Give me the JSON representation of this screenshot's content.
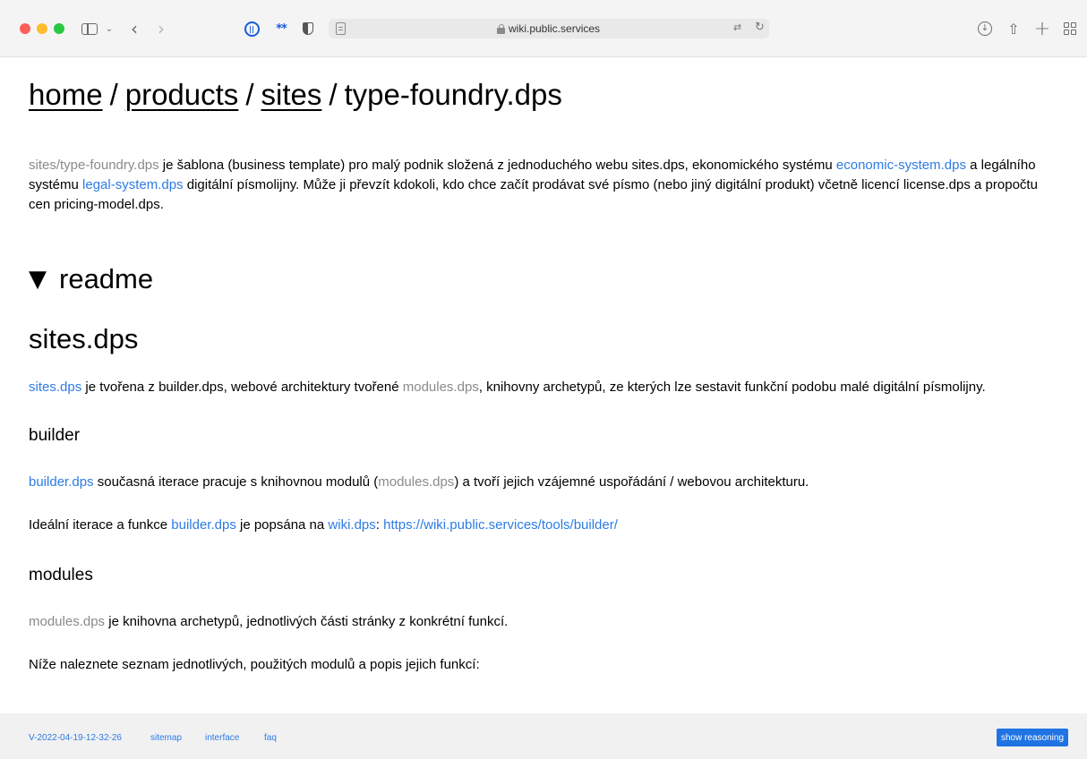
{
  "browser": {
    "url": "wiki.public.services",
    "ext_stars": "**"
  },
  "breadcrumb": {
    "items": [
      "home",
      "products",
      "sites"
    ],
    "separator": "/",
    "current": "type-foundry.dps"
  },
  "intro": {
    "s1": "sites/type-foundry.dps",
    "s2": " je šablona (business template) pro malý podnik složená z jednoduchého webu sites.dps, ekonomického systému ",
    "s3": "economic-system.dps",
    "s4": " a legálního systému ",
    "s5": "legal-system.dps",
    "s6": " digitální písmolijny. Může ji převzít kdokoli, kdo chce začít prodávat své písmo (nebo jiný digitální produkt) včetně licencí license.dps a propočtu cen pricing-model.dps."
  },
  "readme": {
    "toggle_icon": "▼",
    "heading": "readme"
  },
  "sites": {
    "heading": "sites.dps",
    "p1": {
      "link1": "sites.dps",
      "t1": " je tvořena z builder.dps, webové architektury tvořené ",
      "link2": "modules.dps",
      "t2": ", knihovny archetypů, ze kterých lze sestavit funkční podobu malé digitální písmolijny."
    }
  },
  "builder": {
    "heading": "builder",
    "p1": {
      "link1": "builder.dps",
      "t1": " současná iterace pracuje s knihovnou modulů (",
      "link2": "modules.dps",
      "t2": ") a tvoří jejich vzájemné uspořádání / webovou architekturu."
    },
    "p2": {
      "t1": "Ideální iterace a funkce ",
      "link1": "builder.dps",
      "t2": " je popsána na ",
      "link2": "wiki.dps",
      "t3": ": ",
      "link3": "https://wiki.public.services/tools/builder/"
    }
  },
  "modules": {
    "heading": "modules",
    "p1": {
      "link1": "modules.dps",
      "t1": " je knihovna archetypů, jednotlivých části stránky z konkrétní funkcí."
    },
    "p2": "Níže naleznete seznam jednotlivých, použitých modulů a popis jejich funkcí:"
  },
  "footer": {
    "version": "V-2022-04-19-12-32-26",
    "sitemap": "sitemap",
    "interface": "interface",
    "faq": "faq",
    "reason_button": "show reasoning"
  },
  "colors": {
    "link": "#2d7be5",
    "muted_link": "#8a8a8a",
    "button": "#1f73e3"
  }
}
